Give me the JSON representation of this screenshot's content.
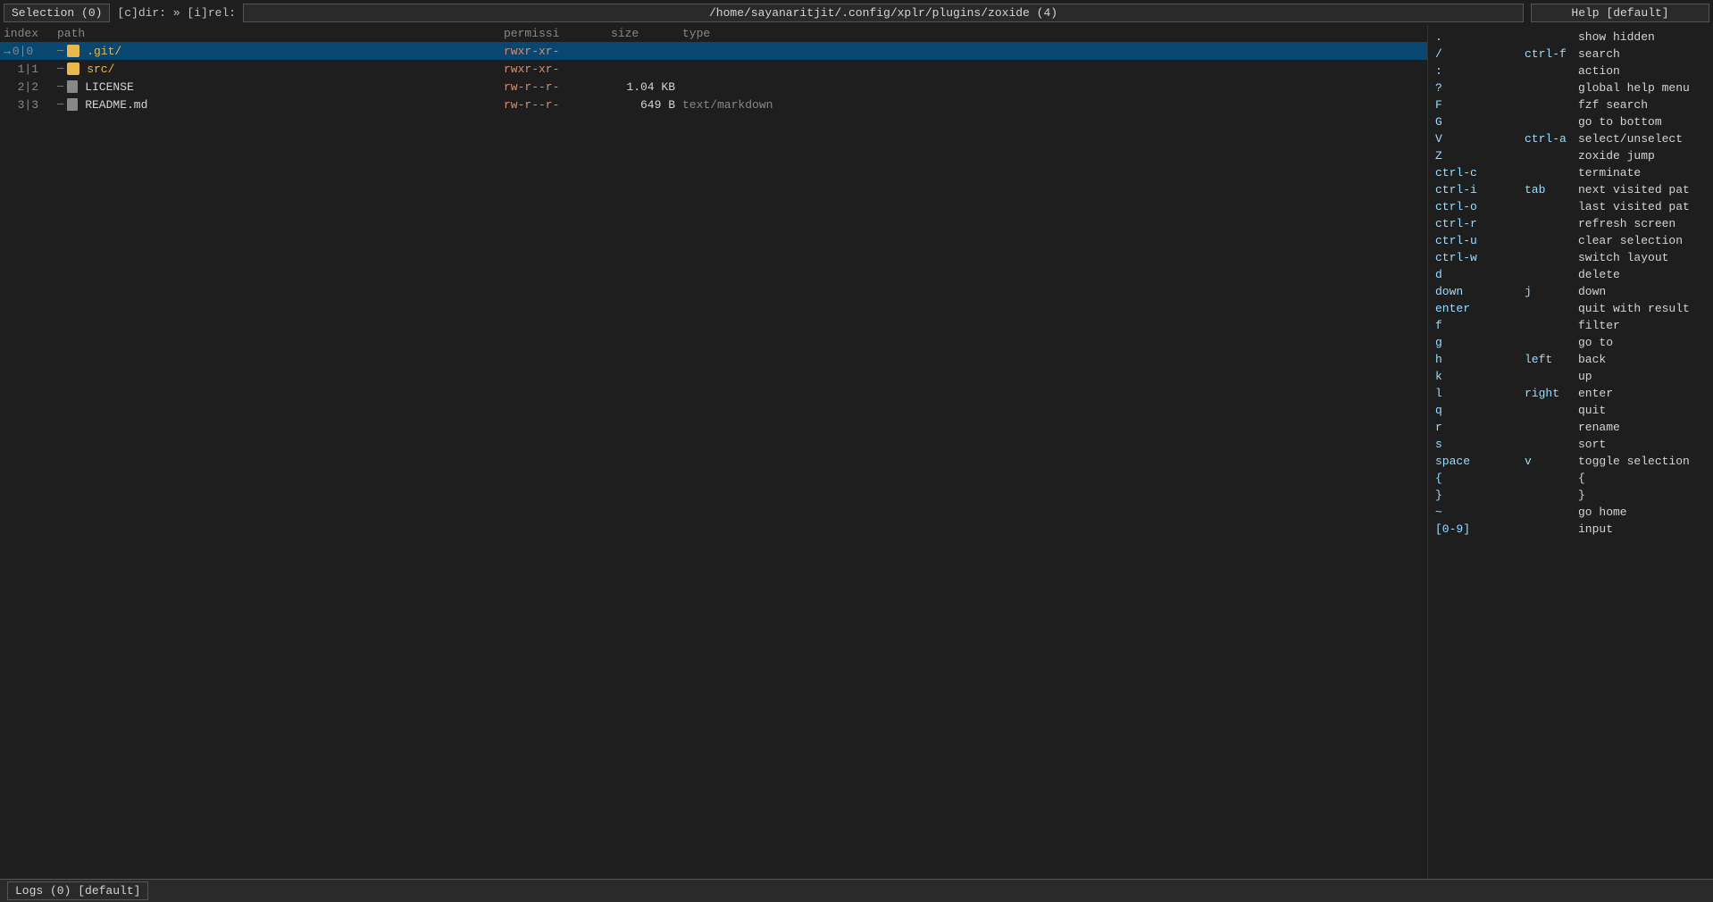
{
  "topbar": {
    "breadcrumb": "[c]dir: » [i]rel:",
    "path": "/home/sayanaritjit/.config/xplr/plugins/zoxide (4)",
    "help_label": "Help [default]",
    "selection_label": "Selection (0)"
  },
  "table": {
    "headers": {
      "index": "index",
      "path": "path",
      "permissions": "permissi",
      "size": "size",
      "type": "type"
    },
    "rows": [
      {
        "index1": "0",
        "index2": "0",
        "cursor": true,
        "arrow": "→",
        "tree": "─",
        "is_folder": true,
        "name": ".git/",
        "permissions": "rwxr-xr-",
        "size": "",
        "type": ""
      },
      {
        "index1": "1",
        "index2": "1",
        "cursor": false,
        "arrow": "",
        "tree": "─",
        "is_folder": true,
        "name": "src/",
        "permissions": "rwxr-xr-",
        "size": "",
        "type": ""
      },
      {
        "index1": "2",
        "index2": "2",
        "cursor": false,
        "arrow": "",
        "tree": "─",
        "is_folder": false,
        "name": "LICENSE",
        "permissions": "rw-r--r-",
        "size": "1.04 KB",
        "type": ""
      },
      {
        "index1": "3",
        "index2": "3",
        "cursor": false,
        "arrow": "",
        "tree": "─",
        "is_folder": false,
        "name": "README.md",
        "permissions": "rw-r--r-",
        "size": "649 B",
        "type": "text/markdown"
      }
    ]
  },
  "help": {
    "title": "Help [default]",
    "entries": [
      {
        "key": ".",
        "alias": "",
        "desc": "show hidden"
      },
      {
        "key": "/",
        "alias": "ctrl-f",
        "desc": "search"
      },
      {
        "key": ":",
        "alias": "",
        "desc": "action"
      },
      {
        "key": "?",
        "alias": "",
        "desc": "global help menu"
      },
      {
        "key": "F",
        "alias": "",
        "desc": "fzf search"
      },
      {
        "key": "G",
        "alias": "",
        "desc": "go to bottom"
      },
      {
        "key": "V",
        "alias": "ctrl-a",
        "desc": "select/unselect"
      },
      {
        "key": "Z",
        "alias": "",
        "desc": "zoxide jump"
      },
      {
        "key": "ctrl-c",
        "alias": "",
        "desc": "terminate"
      },
      {
        "key": "ctrl-i",
        "alias": "tab",
        "desc": "next visited pat"
      },
      {
        "key": "ctrl-o",
        "alias": "",
        "desc": "last visited pat"
      },
      {
        "key": "ctrl-r",
        "alias": "",
        "desc": "refresh screen"
      },
      {
        "key": "ctrl-u",
        "alias": "",
        "desc": "clear selection"
      },
      {
        "key": "ctrl-w",
        "alias": "",
        "desc": "switch layout"
      },
      {
        "key": "d",
        "alias": "",
        "desc": "delete"
      },
      {
        "key": "down",
        "alias": "j",
        "desc": "down"
      },
      {
        "key": "enter",
        "alias": "",
        "desc": "quit with result"
      },
      {
        "key": "f",
        "alias": "",
        "desc": "filter"
      },
      {
        "key": "g",
        "alias": "",
        "desc": "go to"
      },
      {
        "key": "h",
        "alias": "left",
        "desc": "back"
      },
      {
        "key": "k",
        "alias": "",
        "desc": "up"
      },
      {
        "key": "l",
        "alias": "right",
        "desc": "enter"
      },
      {
        "key": "q",
        "alias": "",
        "desc": "quit"
      },
      {
        "key": "r",
        "alias": "",
        "desc": "rename"
      },
      {
        "key": "s",
        "alias": "",
        "desc": "sort"
      },
      {
        "key": "space",
        "alias": "v",
        "desc": "toggle selection"
      },
      {
        "key": "{",
        "alias": "",
        "desc": "{"
      },
      {
        "key": "}",
        "alias": "",
        "desc": "}"
      },
      {
        "key": "~",
        "alias": "",
        "desc": "go home"
      },
      {
        "key": "[0-9]",
        "alias": "",
        "desc": "input"
      }
    ]
  },
  "bottombar": {
    "logs_label": "Logs (0) [default]"
  }
}
